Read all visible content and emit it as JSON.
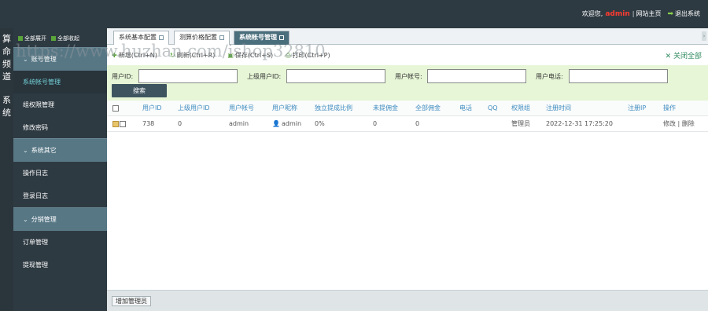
{
  "header": {
    "welcome": "欢迎您,",
    "username": "admin",
    "separator": "|",
    "site_home": "网站主页",
    "logout": "退出系统"
  },
  "left_strip": {
    "label_top": "算命频道",
    "label_bottom": "系统"
  },
  "sidebar": {
    "expand_all": "全部展开",
    "collapse_all": "全部收起",
    "groups": [
      {
        "label": "账号管理",
        "items": [
          "系统帐号管理",
          "组权限管理",
          "修改密码"
        ]
      },
      {
        "label": "系统其它",
        "items": [
          "操作日志",
          "登录日志"
        ]
      },
      {
        "label": "分销管理",
        "items": [
          "订单管理",
          "提现管理"
        ]
      }
    ],
    "active_item": "系统帐号管理"
  },
  "tabs": [
    {
      "label": "系统基本配置"
    },
    {
      "label": "测算价格配置"
    },
    {
      "label": "系统帐号管理",
      "active": true
    }
  ],
  "toolbar": {
    "new": "新增(Ctrl+N)",
    "refresh": "刷新(Ctrl+R)",
    "save": "保存(Ctrl+S)",
    "print": "打印(Ctrl+P)",
    "close_all": "关闭全部"
  },
  "search": {
    "user_id_label": "用户ID:",
    "parent_id_label": "上级用户ID:",
    "account_label": "用户帐号:",
    "phone_label": "用户电话:",
    "user_id_value": "",
    "parent_id_value": "",
    "account_value": "",
    "phone_value": "",
    "button": "搜索"
  },
  "table": {
    "columns": [
      "用户ID",
      "上级用户ID",
      "用户帐号",
      "用户昵称",
      "独立提成比例",
      "未提佣金",
      "全部佣金",
      "电话",
      "QQ",
      "权限组",
      "注册时间",
      "注册IP",
      "操作"
    ],
    "rows": [
      {
        "user_id": "738",
        "parent_id": "0",
        "account": "admin",
        "nickname": "admin",
        "ratio": "0%",
        "unpaid": "0",
        "total": "0",
        "phone": "",
        "qq": "",
        "group": "管理员",
        "reg_time": "2022-12-31 17:25:20",
        "reg_ip": "",
        "edit": "修改",
        "op_sep": "|",
        "delete": "删除"
      }
    ]
  },
  "footer": {
    "add_admin": "增加管理员"
  },
  "watermark": "https://www.huzhan.com/ishop32810",
  "colors": {
    "header_bg": "#2e3a42",
    "group_bg": "#577785",
    "active_item": "#74d0d8",
    "search_bg": "#e6f6d6",
    "username": "#ff3b30"
  }
}
